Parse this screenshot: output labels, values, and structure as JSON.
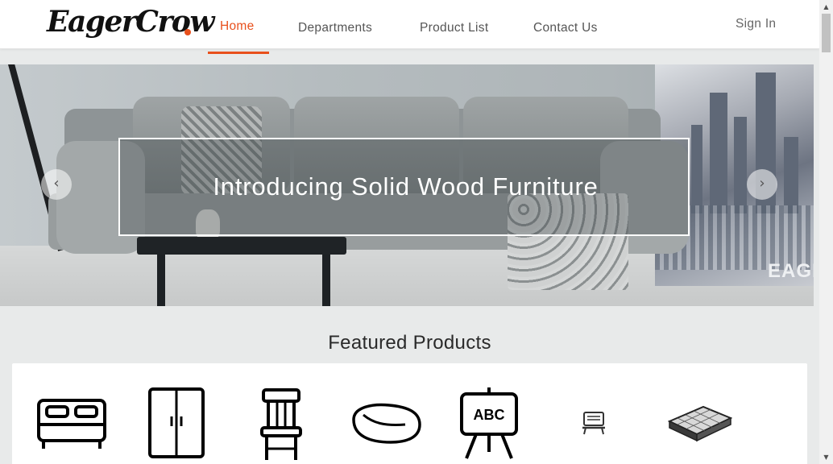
{
  "header": {
    "logo": "EagerCrow",
    "nav": [
      {
        "label": "Home",
        "active": true
      },
      {
        "label": "Departments",
        "active": false
      },
      {
        "label": "Product List",
        "active": false
      },
      {
        "label": "Contact Us",
        "active": false
      }
    ],
    "sign_in": "Sign In"
  },
  "hero": {
    "title": "Introducing Solid Wood Furniture",
    "painting_text": "EAGI",
    "prev_icon": "chevron-left-icon",
    "next_icon": "chevron-right-icon"
  },
  "featured": {
    "title": "Featured Products",
    "items": [
      {
        "icon": "bed-icon"
      },
      {
        "icon": "wardrobe-icon"
      },
      {
        "icon": "chair-icon"
      },
      {
        "icon": "bean-bag-icon"
      },
      {
        "icon": "easel-board-icon"
      },
      {
        "icon": "laptop-stand-icon"
      },
      {
        "icon": "mattress-icon"
      }
    ],
    "easel_text": "ABC"
  },
  "colors": {
    "accent": "#e8501c",
    "background": "#e8eaea",
    "card": "#ffffff"
  }
}
